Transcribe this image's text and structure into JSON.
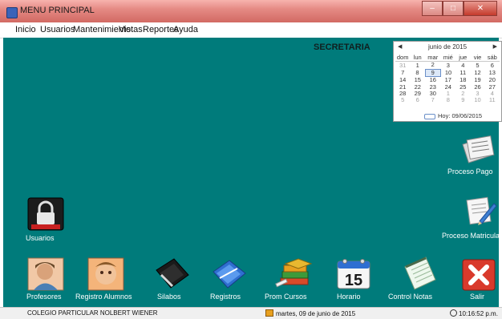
{
  "window": {
    "title": "MENU PRINCIPAL"
  },
  "menu": [
    "Inicio",
    "Usuarios",
    "Mantenimiento",
    "Vistas",
    "Reportes",
    "Ayuda"
  ],
  "role_label": "SECRETARIA",
  "calendar": {
    "month_label": "junio de 2015",
    "weekdays": [
      "dom",
      "lun",
      "mar",
      "mié",
      "jue",
      "vie",
      "sáb"
    ],
    "weeks": [
      [
        "31",
        "1",
        "2",
        "3",
        "4",
        "5",
        "6"
      ],
      [
        "7",
        "8",
        "9",
        "10",
        "11",
        "12",
        "13"
      ],
      [
        "14",
        "15",
        "16",
        "17",
        "18",
        "19",
        "20"
      ],
      [
        "21",
        "22",
        "23",
        "24",
        "25",
        "26",
        "27"
      ],
      [
        "28",
        "29",
        "30",
        "1",
        "2",
        "3",
        "4"
      ],
      [
        "5",
        "6",
        "7",
        "8",
        "9",
        "10",
        "11"
      ]
    ],
    "selected_day": "9",
    "today_label": "Hoy: 09/06/2015"
  },
  "desktop_icons": {
    "usuarios": "Usuarios",
    "proceso_pago": "Proceso Pago",
    "proceso_matricula": "Proceso Matricula",
    "profesores": "Profesores",
    "registro_alumnos": "Registro Alumnos",
    "silabos": "Silabos",
    "registros": "Registros",
    "prom_cursos": "Prom Cursos",
    "horario": "Horario",
    "horario_number": "15",
    "control_notas": "Control Notas",
    "salir": "Salir"
  },
  "status": {
    "school": "COLEGIO PARTICULAR NOLBERT WIENER",
    "date": "martes, 09 de junio de 2015",
    "time": "10:16:52 p.m."
  },
  "colors": {
    "desktop": "#007b7b",
    "titlebar": "#e58a84",
    "exit_red": "#d93a2c"
  }
}
